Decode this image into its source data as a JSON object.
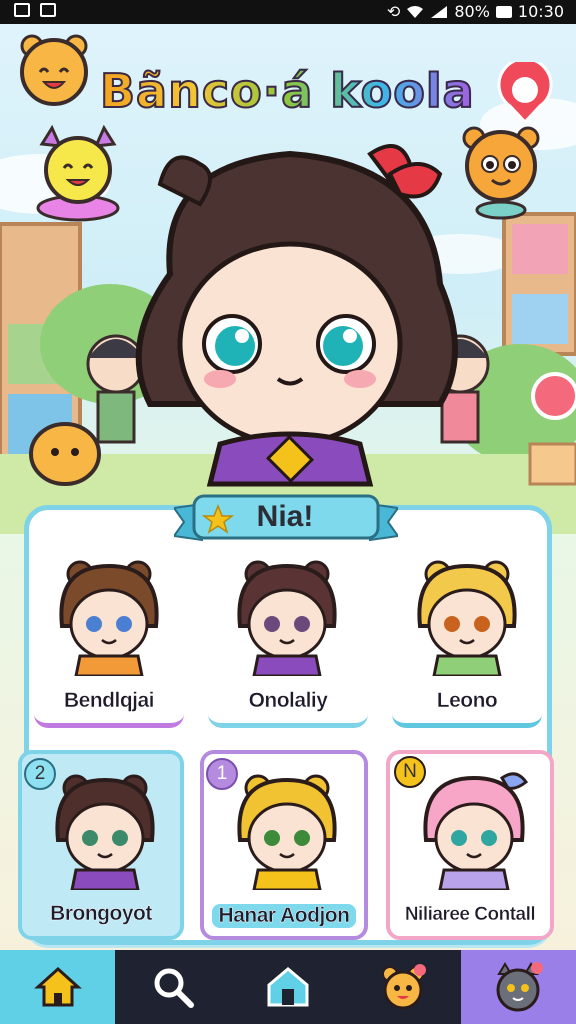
{
  "status_bar": {
    "time": "10:30",
    "battery": "80%"
  },
  "app": {
    "title": "Bãnco·á koola"
  },
  "selection": {
    "header": "Nia!"
  },
  "characters": [
    {
      "name": "Bendlqjai",
      "badge": ""
    },
    {
      "name": "Onolaliy",
      "badge": ""
    },
    {
      "name": "Leono",
      "badge": ""
    },
    {
      "name": "Brongoyot",
      "badge": "2"
    },
    {
      "name": "Hanar Aodjon",
      "badge": "1"
    },
    {
      "name": "Niliaree Contall",
      "badge": "N"
    }
  ],
  "bottom_nav": {
    "items": [
      {
        "icon": "home-icon"
      },
      {
        "icon": "search-icon"
      },
      {
        "icon": "house-outline-icon"
      },
      {
        "icon": "mascot-icon"
      },
      {
        "icon": "profile-avatar-icon"
      }
    ]
  },
  "colors": {
    "accent": "#7fd3e8",
    "nav_bg": "#1f2230",
    "nav_active": "#5fd0e6",
    "nav_profile": "#9b7fe8"
  }
}
